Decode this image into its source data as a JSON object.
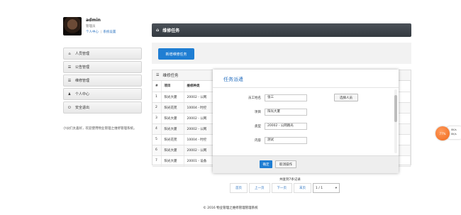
{
  "user": {
    "name": "admin",
    "role": "管理员",
    "links": [
      "个人中心",
      "系统设置"
    ],
    "link_sep": "|"
  },
  "sidebar": {
    "items": [
      {
        "label": "人员管理",
        "icon": "home-icon",
        "glyph": "⌂"
      },
      {
        "label": "公告管理",
        "icon": "list-icon",
        "glyph": "☰"
      },
      {
        "label": "维修管理",
        "icon": "list-icon",
        "glyph": "☰"
      },
      {
        "label": "个人中心",
        "icon": "user-icon",
        "glyph": "♟"
      },
      {
        "label": "安全退出",
        "icon": "power-icon",
        "glyph": "⏻"
      }
    ],
    "welcome": "小伙们太喜好，欢迎使用物业管理之维修管理系统。"
  },
  "header": {
    "title": "维修任务"
  },
  "toolbar": {
    "new_button": "新增维修任务"
  },
  "table": {
    "title": "维修任务",
    "columns": [
      "#",
      "项目",
      "维修种类"
    ],
    "rows": [
      [
        "1",
        "阳光大厦",
        "20002 - 公网"
      ],
      [
        "2",
        "阳光花苑",
        "10004 - 时控"
      ],
      [
        "3",
        "阳光大厦",
        "20002 - 公网"
      ],
      [
        "4",
        "阳光大厦",
        "20002 - 公网"
      ],
      [
        "5",
        "阳光花苑",
        "10004 - 时控"
      ],
      [
        "6",
        "阳光大厦",
        "20002 - 公网"
      ],
      [
        "7",
        "阳光大厦",
        "20001 - 设备"
      ]
    ]
  },
  "modal": {
    "title": "任务派遣",
    "fields": [
      {
        "label": "员工姓名",
        "value": "张三"
      },
      {
        "label": "项目",
        "value": "阳光大厦"
      },
      {
        "label": "类型",
        "value": "20002 - 公网路光"
      },
      {
        "label": "内容",
        "value": "测试"
      }
    ],
    "select_button": "选择人员",
    "ok": "确定",
    "cancel": "取消操作"
  },
  "pager": {
    "summary": "共查到7条记录",
    "buttons": [
      "首页",
      "上一页",
      "下一页",
      "末页"
    ],
    "current": "1 / 1"
  },
  "footer": "© 2016 物业管理之维修管理管理系统",
  "float_widget": {
    "badge": "77%",
    "lines": [
      "0K/s",
      "0K/s"
    ]
  },
  "colors": {
    "primary": "#1f7ed3",
    "header": "#3d434a",
    "link": "#2a72c0",
    "widget": "#f06a1e"
  }
}
